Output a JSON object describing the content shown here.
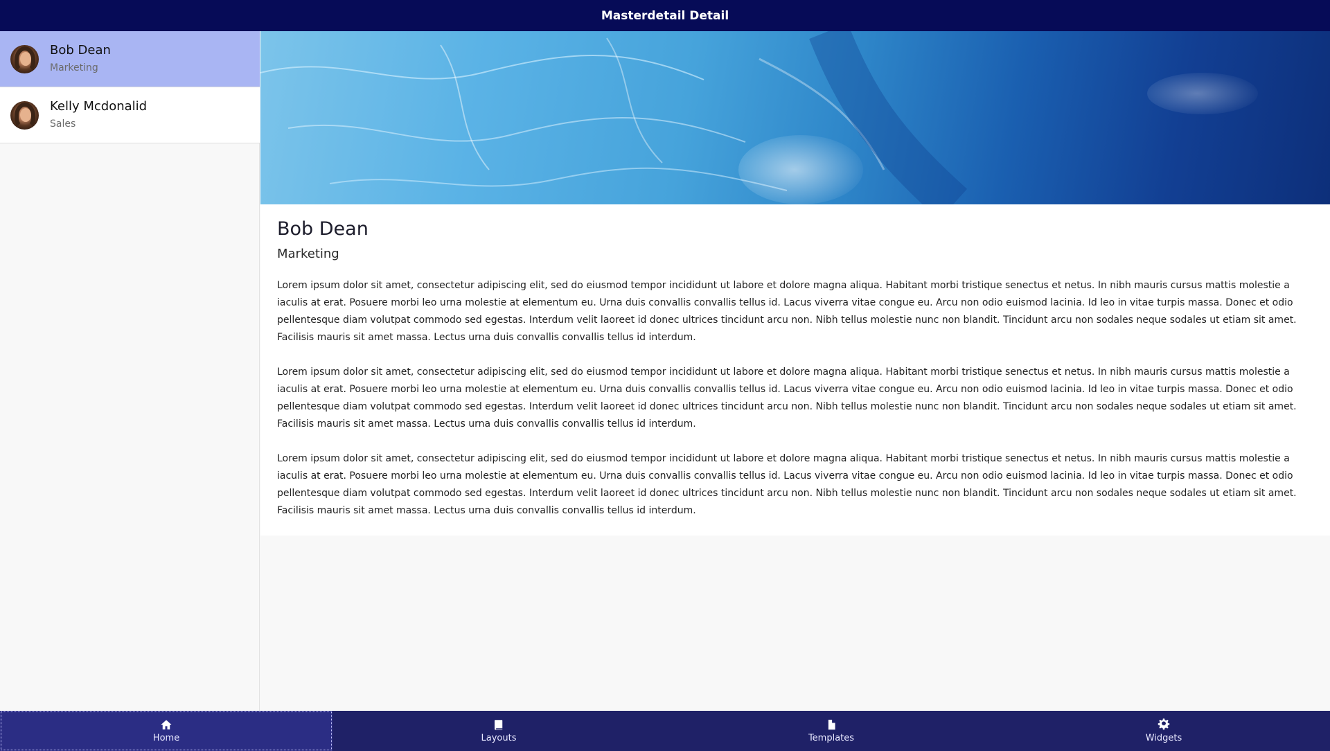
{
  "app": {
    "title": "Masterdetail Detail"
  },
  "master": {
    "items": [
      {
        "name": "Bob Dean",
        "department": "Marketing",
        "selected": true
      },
      {
        "name": "Kelly Mcdonalid",
        "department": "Sales",
        "selected": false
      }
    ]
  },
  "detail": {
    "name": "Bob Dean",
    "department": "Marketing",
    "paragraphs": [
      "Lorem ipsum dolor sit amet, consectetur adipiscing elit, sed do eiusmod tempor incididunt ut labore et dolore magna aliqua. Habitant morbi tristique senectus et netus. In nibh mauris cursus mattis molestie a iaculis at erat. Posuere morbi leo urna molestie at elementum eu. Urna duis convallis convallis tellus id. Lacus viverra vitae congue eu. Arcu non odio euismod lacinia. Id leo in vitae turpis massa. Donec et odio pellentesque diam volutpat commodo sed egestas. Interdum velit laoreet id donec ultrices tincidunt arcu non. Nibh tellus molestie nunc non blandit. Tincidunt arcu non sodales neque sodales ut etiam sit amet. Facilisis mauris sit amet massa. Lectus urna duis convallis convallis tellus id interdum.",
      "Lorem ipsum dolor sit amet, consectetur adipiscing elit, sed do eiusmod tempor incididunt ut labore et dolore magna aliqua. Habitant morbi tristique senectus et netus. In nibh mauris cursus mattis molestie a iaculis at erat. Posuere morbi leo urna molestie at elementum eu. Urna duis convallis convallis tellus id. Lacus viverra vitae congue eu. Arcu non odio euismod lacinia. Id leo in vitae turpis massa. Donec et odio pellentesque diam volutpat commodo sed egestas. Interdum velit laoreet id donec ultrices tincidunt arcu non. Nibh tellus molestie nunc non blandit. Tincidunt arcu non sodales neque sodales ut etiam sit amet. Facilisis mauris sit amet massa. Lectus urna duis convallis convallis tellus id interdum.",
      "Lorem ipsum dolor sit amet, consectetur adipiscing elit, sed do eiusmod tempor incididunt ut labore et dolore magna aliqua. Habitant morbi tristique senectus et netus. In nibh mauris cursus mattis molestie a iaculis at erat. Posuere morbi leo urna molestie at elementum eu. Urna duis convallis convallis tellus id. Lacus viverra vitae congue eu. Arcu non odio euismod lacinia. Id leo in vitae turpis massa. Donec et odio pellentesque diam volutpat commodo sed egestas. Interdum velit laoreet id donec ultrices tincidunt arcu non. Nibh tellus molestie nunc non blandit. Tincidunt arcu non sodales neque sodales ut etiam sit amet. Facilisis mauris sit amet massa. Lectus urna duis convallis convallis tellus id interdum."
    ]
  },
  "tabs": [
    {
      "label": "Home",
      "icon": "home-icon",
      "active": true
    },
    {
      "label": "Layouts",
      "icon": "book-icon",
      "active": false
    },
    {
      "label": "Templates",
      "icon": "file-icon",
      "active": false
    },
    {
      "label": "Widgets",
      "icon": "gear-icon",
      "active": false
    }
  ],
  "colors": {
    "topbar": "#060b57",
    "selected_item": "#a9b5f3",
    "tabbar": "#1f2167",
    "active_tab": "#2b2d84"
  }
}
